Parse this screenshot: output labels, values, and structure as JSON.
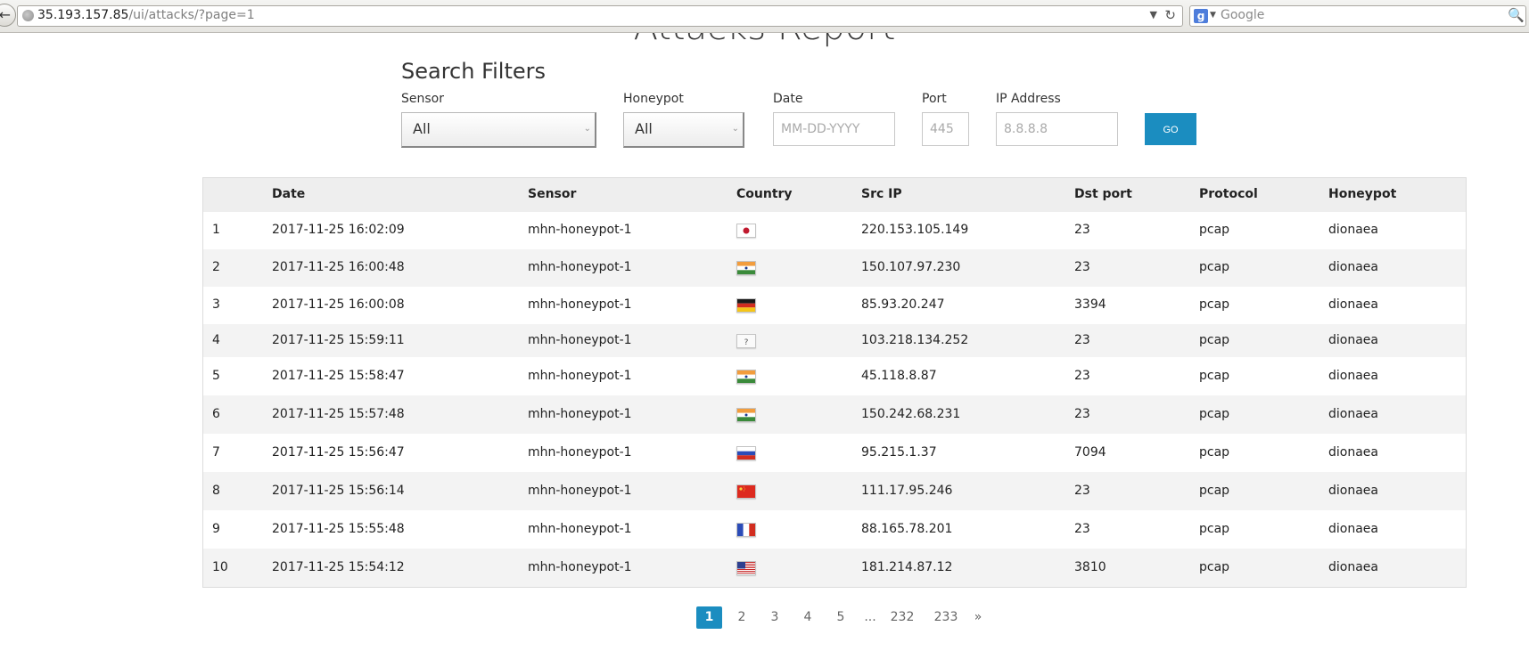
{
  "browser": {
    "back_glyph": "←",
    "url_host": "35.193.157.85",
    "url_path": "/ui/attacks/?page=1",
    "url_dropdown_glyph": "▼",
    "reload_glyph": "↻",
    "search_engine_letter": "g",
    "search_engine_drop_glyph": "▼",
    "search_placeholder": "Google",
    "search_glyph": "🔍"
  },
  "page": {
    "title": "Attacks Report"
  },
  "filters": {
    "title": "Search Filters",
    "sensor_label": "Sensor",
    "sensor_value": "All",
    "honeypot_label": "Honeypot",
    "honeypot_value": "All",
    "date_label": "Date",
    "date_placeholder": "MM-DD-YYYY",
    "port_label": "Port",
    "port_placeholder": "445",
    "ip_label": "IP Address",
    "ip_placeholder": "8.8.8.8",
    "go_label": "GO",
    "caret_glyph": "⌄"
  },
  "table": {
    "headers": [
      "",
      "Date",
      "Sensor",
      "Country",
      "Src IP",
      "Dst port",
      "Protocol",
      "Honeypot"
    ],
    "rows": [
      {
        "num": "1",
        "date": "2017-11-25 16:02:09",
        "sensor": "mhn-honeypot-1",
        "country": "japan",
        "src_ip": "220.153.105.149",
        "dst_port": "23",
        "protocol": "pcap",
        "honeypot": "dionaea"
      },
      {
        "num": "2",
        "date": "2017-11-25 16:00:48",
        "sensor": "mhn-honeypot-1",
        "country": "india",
        "src_ip": "150.107.97.230",
        "dst_port": "23",
        "protocol": "pcap",
        "honeypot": "dionaea"
      },
      {
        "num": "3",
        "date": "2017-11-25 16:00:08",
        "sensor": "mhn-honeypot-1",
        "country": "germany",
        "src_ip": "85.93.20.247",
        "dst_port": "3394",
        "protocol": "pcap",
        "honeypot": "dionaea"
      },
      {
        "num": "4",
        "date": "2017-11-25 15:59:11",
        "sensor": "mhn-honeypot-1",
        "country": "unknown",
        "src_ip": "103.218.134.252",
        "dst_port": "23",
        "protocol": "pcap",
        "honeypot": "dionaea"
      },
      {
        "num": "5",
        "date": "2017-11-25 15:58:47",
        "sensor": "mhn-honeypot-1",
        "country": "india",
        "src_ip": "45.118.8.87",
        "dst_port": "23",
        "protocol": "pcap",
        "honeypot": "dionaea"
      },
      {
        "num": "6",
        "date": "2017-11-25 15:57:48",
        "sensor": "mhn-honeypot-1",
        "country": "india",
        "src_ip": "150.242.68.231",
        "dst_port": "23",
        "protocol": "pcap",
        "honeypot": "dionaea"
      },
      {
        "num": "7",
        "date": "2017-11-25 15:56:47",
        "sensor": "mhn-honeypot-1",
        "country": "russia",
        "src_ip": "95.215.1.37",
        "dst_port": "7094",
        "protocol": "pcap",
        "honeypot": "dionaea"
      },
      {
        "num": "8",
        "date": "2017-11-25 15:56:14",
        "sensor": "mhn-honeypot-1",
        "country": "china",
        "src_ip": "111.17.95.246",
        "dst_port": "23",
        "protocol": "pcap",
        "honeypot": "dionaea"
      },
      {
        "num": "9",
        "date": "2017-11-25 15:55:48",
        "sensor": "mhn-honeypot-1",
        "country": "france",
        "src_ip": "88.165.78.201",
        "dst_port": "23",
        "protocol": "pcap",
        "honeypot": "dionaea"
      },
      {
        "num": "10",
        "date": "2017-11-25 15:54:12",
        "sensor": "mhn-honeypot-1",
        "country": "usa",
        "src_ip": "181.214.87.12",
        "dst_port": "3810",
        "protocol": "pcap",
        "honeypot": "dionaea"
      }
    ],
    "unknown_flag_glyph": "?"
  },
  "pagination": {
    "pages": [
      "1",
      "2",
      "3",
      "4",
      "5",
      "...",
      "232",
      "233",
      "»"
    ],
    "current": "1"
  },
  "colors": {
    "accent": "#1b8dc0",
    "row_alt": "#f3f3f3",
    "header_bg": "#eeeeee"
  }
}
